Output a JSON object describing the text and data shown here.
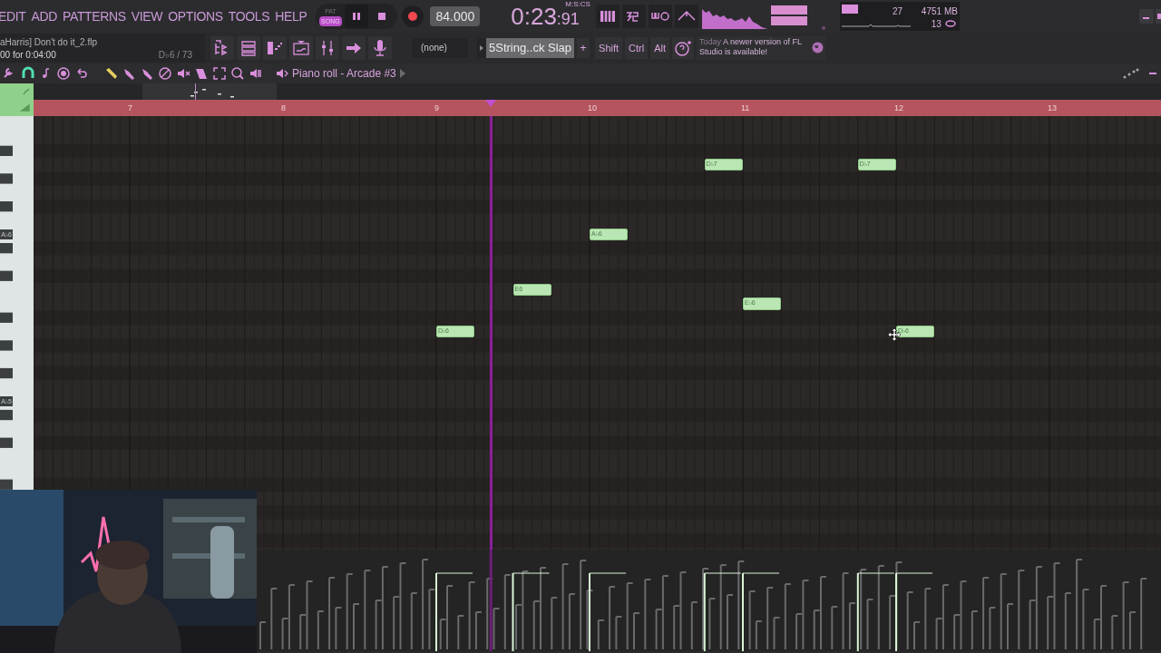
{
  "menu": [
    "EDIT",
    "ADD",
    "PATTERNS",
    "VIEW",
    "OPTIONS",
    "TOOLS",
    "HELP"
  ],
  "transport": {
    "modes": [
      {
        "label": "PAT",
        "selected": false
      },
      {
        "label": "SONG",
        "selected": true
      }
    ],
    "tempo": "84.000",
    "time": "0:23",
    "time_cs": ":91",
    "time_format": "M:S:CS"
  },
  "monitor": {
    "cpu": "27",
    "memory": "4751 MB",
    "polyphony": "13"
  },
  "hint": {
    "file": "aHarris] Don't do it_2.flp",
    "duration": "00 for 0:04:00",
    "note": "D♭6 / 73"
  },
  "toolbar": {
    "pattern": "(none)",
    "channel": "5String..ck Slap",
    "add": "+",
    "modifiers": [
      "Shift",
      "Ctrl",
      "Alt"
    ],
    "news_date": "Today",
    "news": "A newer version of FL Studio is available!"
  },
  "piano_roll": {
    "title": "Piano roll - Arcade #3",
    "bars": [
      "7",
      "8",
      "9",
      "10",
      "11",
      "12",
      "13"
    ],
    "key_labels": [
      "A♭6",
      "A♭5"
    ],
    "notes": [
      "D♭6",
      "E6",
      "A♭6",
      "D♭7",
      "E♭6",
      "D♭7",
      "D♭6"
    ]
  }
}
